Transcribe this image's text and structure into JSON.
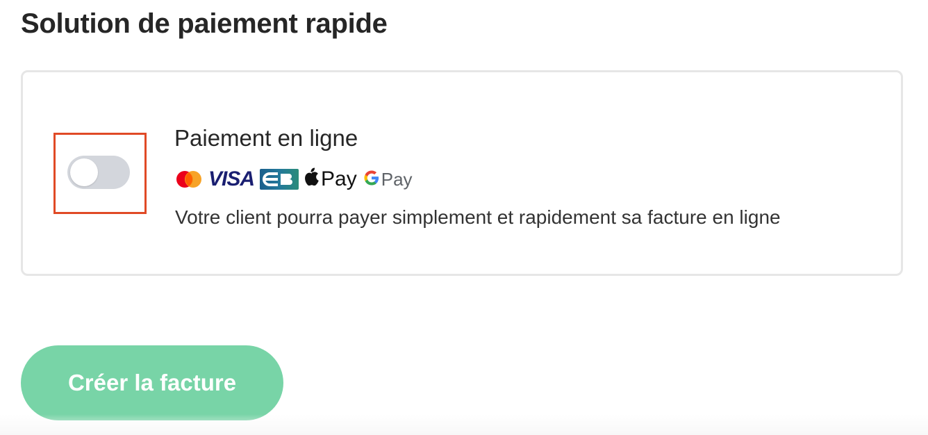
{
  "section": {
    "title": "Solution de paiement rapide"
  },
  "payment_option": {
    "title": "Paiement en ligne",
    "description": "Votre client pourra payer simplement et rapidement sa facture en ligne",
    "toggle_enabled": false,
    "logos": {
      "mastercard": "mastercard-icon",
      "visa": "VISA",
      "cb": "cb-icon",
      "apple_pay_label": "Pay",
      "google_pay_label": "Pay"
    }
  },
  "actions": {
    "create_invoice_label": "Créer la facture"
  },
  "colors": {
    "highlight": "#e04a26",
    "button": "#78d4a7",
    "toggle_off": "#d3d6dc",
    "visa": "#1a1f71"
  }
}
